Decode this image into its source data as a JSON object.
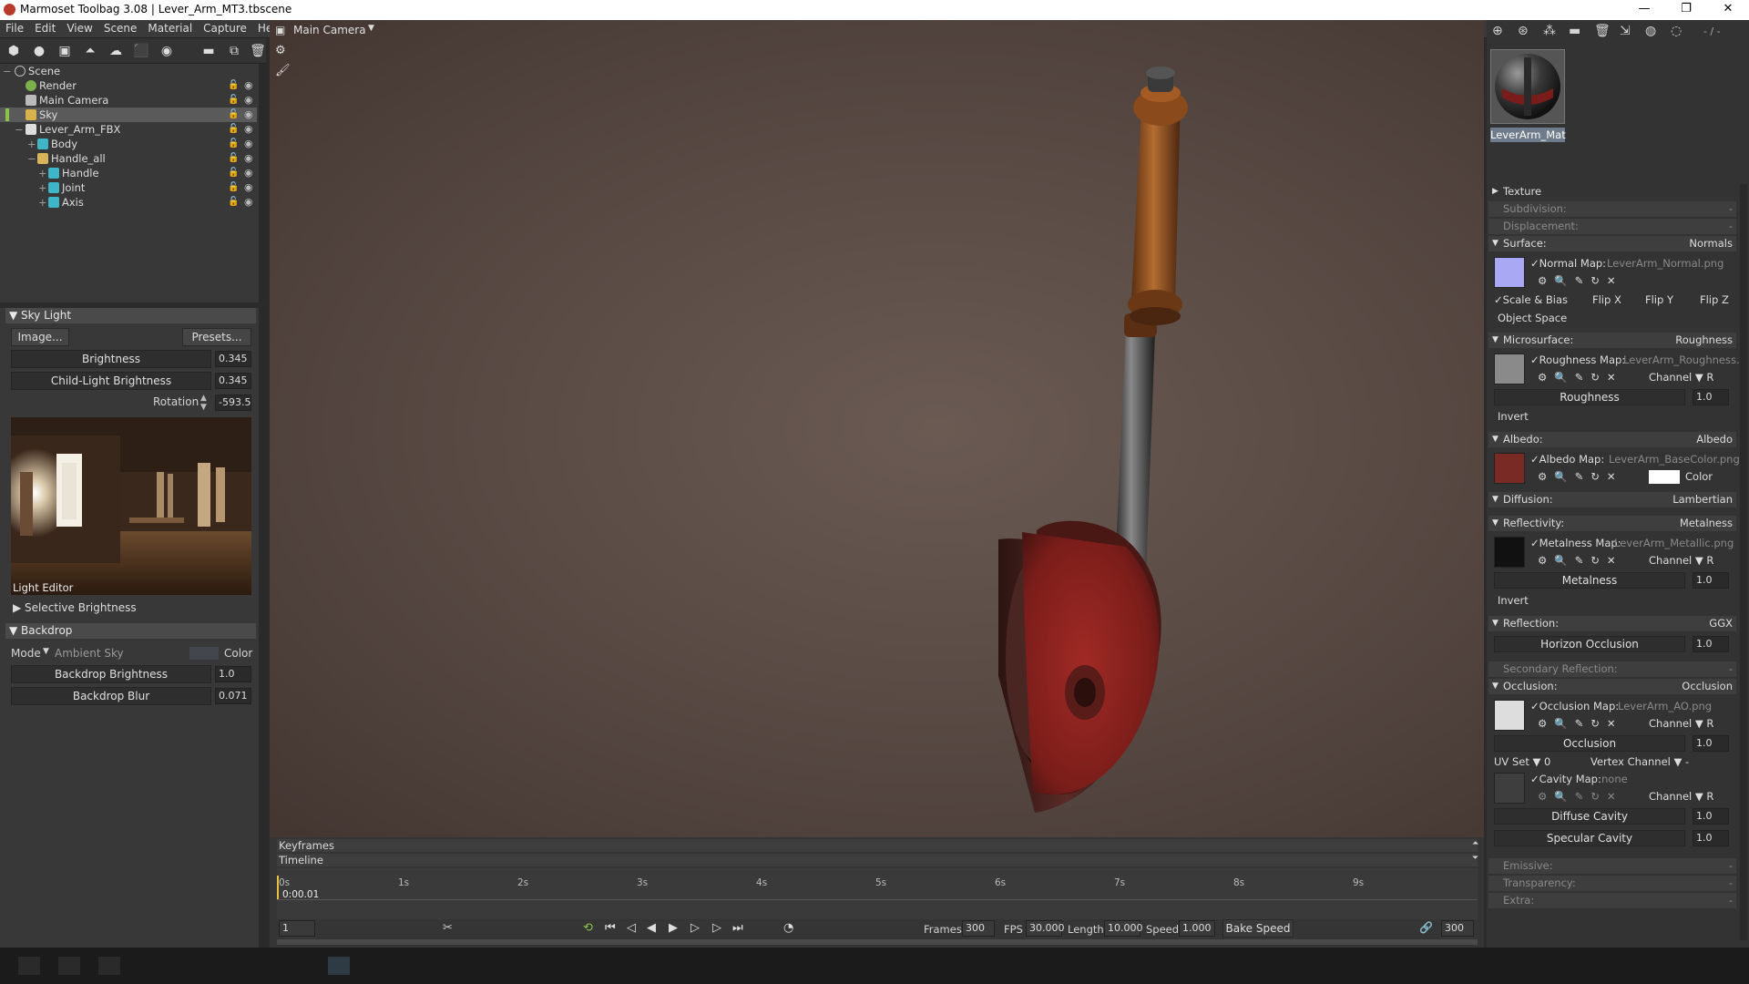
{
  "app": {
    "title": "Marmoset Toolbag 3.08  |  Lever_Arm_MT3.tbscene",
    "min": "—",
    "max": "❐",
    "close": "✕"
  },
  "menu": [
    "File",
    "Edit",
    "View",
    "Scene",
    "Material",
    "Capture",
    "Help"
  ],
  "scene_tree": [
    {
      "label": "Scene",
      "icon": "scene-icon"
    },
    {
      "label": "Render",
      "icon": "render-icon"
    },
    {
      "label": "Main Camera",
      "icon": "camera-icon"
    },
    {
      "label": "Sky",
      "icon": "sky-icon"
    },
    {
      "label": "Lever_Arm_FBX",
      "icon": "mesh-file-icon"
    },
    {
      "label": "Body",
      "icon": "mesh-icon"
    },
    {
      "label": "Handle_all",
      "icon": "folder-icon"
    },
    {
      "label": "Handle",
      "icon": "mesh-icon"
    },
    {
      "label": "Joint",
      "icon": "mesh-icon"
    },
    {
      "label": "Axis",
      "icon": "mesh-icon"
    }
  ],
  "sky": {
    "section": "Sky Light",
    "image_btn": "Image...",
    "presets_btn": "Presets...",
    "brightness_label": "Brightness",
    "brightness": "0.345",
    "child_label": "Child-Light Brightness",
    "child": "0.345",
    "rotation_label": "Rotation",
    "rotation": "-593.5",
    "light_editor": "Light Editor",
    "selective": "Selective Brightness"
  },
  "backdrop": {
    "section": "Backdrop",
    "mode_label": "Mode",
    "mode_value": "Ambient Sky",
    "color_label": "Color",
    "brightness_label": "Backdrop Brightness",
    "brightness": "1.0",
    "blur_label": "Backdrop Blur",
    "blur": "0.071"
  },
  "viewport": {
    "camera": "Main Camera"
  },
  "timeline": {
    "keyframes": "Keyframes",
    "timeline": "Timeline",
    "ticks": [
      "0s",
      "1s",
      "2s",
      "3s",
      "4s",
      "5s",
      "6s",
      "7s",
      "8s",
      "9s"
    ],
    "current_time": "0:00.01",
    "frame": "1",
    "frames_label": "Frames",
    "frames": "300",
    "fps_label": "FPS",
    "fps": "30.000",
    "length_label": "Length",
    "length": "10.000",
    "speed_label": "Speed",
    "speed": "1.000",
    "bake_speed": "Bake Speed",
    "end_frame": "300"
  },
  "material": {
    "name": "LeverArm_Mat",
    "counter": "- / -",
    "texture": "Texture",
    "subdivision": "Subdivision:",
    "subdivision_v": "-",
    "displacement": "Displacement:",
    "displacement_v": "-",
    "surface": "Surface:",
    "surface_v": "Normals",
    "normal_map": "Normal Map:",
    "normal_file": "LeverArm_Normal.png",
    "scale_bias": "Scale & Bias",
    "flipx": "Flip X",
    "flipy": "Flip Y",
    "flipz": "Flip Z",
    "object_space": "Object Space",
    "microsurface": "Microsurface:",
    "microsurface_v": "Roughness",
    "rough_map": "Roughness Map:",
    "rough_file": "LeverArm_Roughness.p",
    "channel": "Channel",
    "channel_r": "R",
    "roughness": "Roughness",
    "roughness_v": "1.0",
    "invert": "Invert",
    "albedo": "Albedo:",
    "albedo_v": "Albedo",
    "albedo_map": "Albedo Map:",
    "albedo_file": "LeverArm_BaseColor.png",
    "color": "Color",
    "diffusion": "Diffusion:",
    "diffusion_v": "Lambertian",
    "reflectivity": "Reflectivity:",
    "reflectivity_v": "Metalness",
    "metal_map": "Metalness Map:",
    "metal_file": "LeverArm_Metallic.png",
    "metalness": "Metalness",
    "metalness_v": "1.0",
    "reflection": "Reflection:",
    "reflection_v": "GGX",
    "horizon": "Horizon Occlusion",
    "horizon_v": "1.0",
    "secondary": "Secondary Reflection:",
    "secondary_v": "-",
    "occlusion": "Occlusion:",
    "occlusion_v": "Occlusion",
    "ao_map": "Occlusion Map:",
    "ao_file": "LeverArm_AO.png",
    "occlusion_s": "Occlusion",
    "occlusion_sv": "1.0",
    "uvset": "UV Set",
    "uvset_v": "0",
    "vertex_channel": "Vertex Channel",
    "vertex_channel_v": "-",
    "cavity_map": "Cavity Map:",
    "cavity_file": "none",
    "diffuse_cavity": "Diffuse Cavity",
    "diffuse_cavity_v": "1.0",
    "specular_cavity": "Specular Cavity",
    "specular_cavity_v": "1.0",
    "emissive": "Emissive:",
    "emissive_v": "-",
    "transparency": "Transparency:",
    "transparency_v": "-",
    "extra": "Extra:",
    "extra_v": "-"
  }
}
